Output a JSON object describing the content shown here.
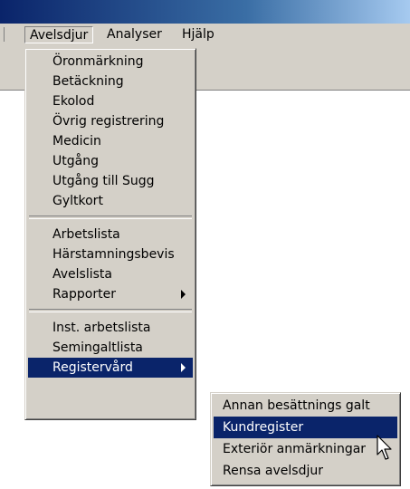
{
  "menubar": {
    "items": [
      {
        "label": "Avelsdjur"
      },
      {
        "label": "Analyser"
      },
      {
        "label": "Hjälp"
      }
    ]
  },
  "main_menu": {
    "group1": [
      "Öronmärkning",
      "Betäckning",
      "Ekolod",
      "Övrig registrering",
      "Medicin",
      "Utgång",
      "Utgång till Sugg",
      "Gyltkort"
    ],
    "group2": [
      "Arbetslista",
      "Härstamningsbevis",
      "Avelslista",
      "Rapporter"
    ],
    "group3": [
      "Inst. arbetslista",
      "Semingaltlista",
      "Registervård"
    ]
  },
  "sub_menu": {
    "items": [
      "Annan besättnings galt",
      "Kundregister",
      "Exteriör anmärkningar",
      "Rensa avelsdjur"
    ]
  },
  "colors": {
    "menu_bg": "#d4d0c8",
    "highlight": "#0a246a",
    "titlebar_start": "#0a246a",
    "titlebar_end": "#a6caf0"
  },
  "icons": {
    "submenu_arrow": "triangle-right-icon",
    "mouse_cursor": "arrow-cursor-icon"
  }
}
